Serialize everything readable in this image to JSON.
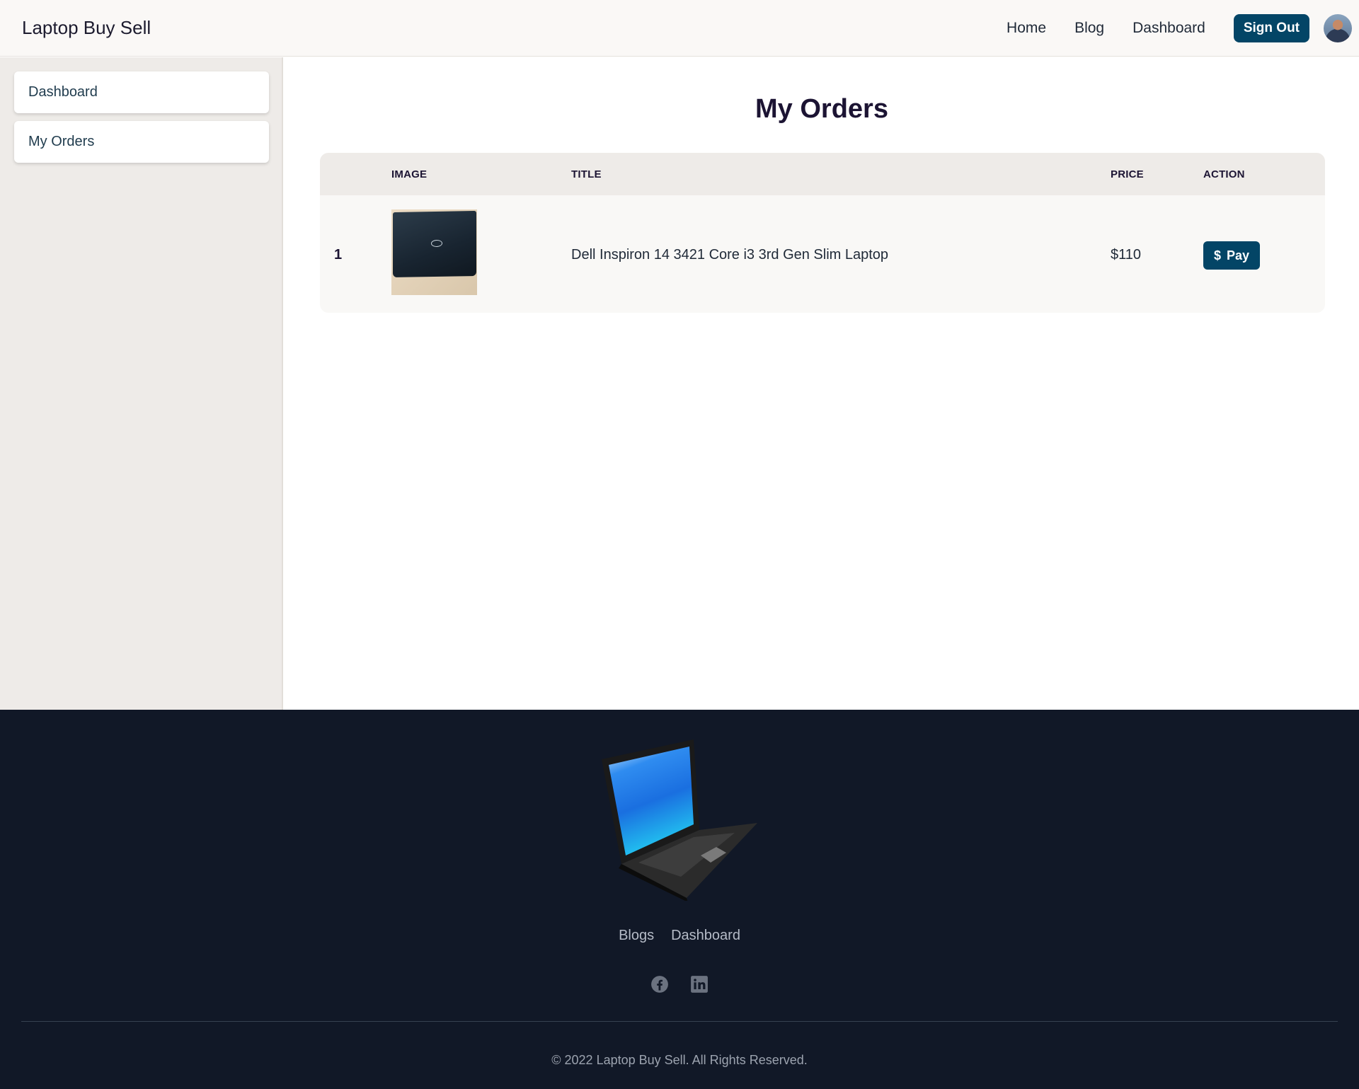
{
  "header": {
    "brand": "Laptop Buy Sell",
    "nav": [
      {
        "label": "Home"
      },
      {
        "label": "Blog"
      },
      {
        "label": "Dashboard"
      }
    ],
    "signout_label": "Sign Out"
  },
  "sidebar": {
    "items": [
      {
        "label": "Dashboard"
      },
      {
        "label": "My Orders"
      }
    ]
  },
  "main": {
    "title": "My Orders",
    "table": {
      "columns": [
        "IMAGE",
        "TITLE",
        "PRICE",
        "ACTION"
      ],
      "rows": [
        {
          "index": "1",
          "image_icon": "laptop-thumbnail",
          "title": "Dell Inspiron 14 3421 Core i3 3rd Gen Slim Laptop",
          "price": "$110",
          "action_label": "Pay",
          "action_icon": "dollar-icon"
        }
      ]
    }
  },
  "footer": {
    "links": [
      {
        "label": "Blogs"
      },
      {
        "label": "Dashboard"
      }
    ],
    "social_icons": [
      "facebook-icon",
      "linkedin-icon"
    ],
    "copyright": "© 2022 Laptop Buy Sell. All Rights Reserved."
  },
  "colors": {
    "accent": "#034566",
    "footer_bg": "#111827",
    "sidebar_bg": "#eeebe8",
    "header_bg": "#faf8f6"
  }
}
